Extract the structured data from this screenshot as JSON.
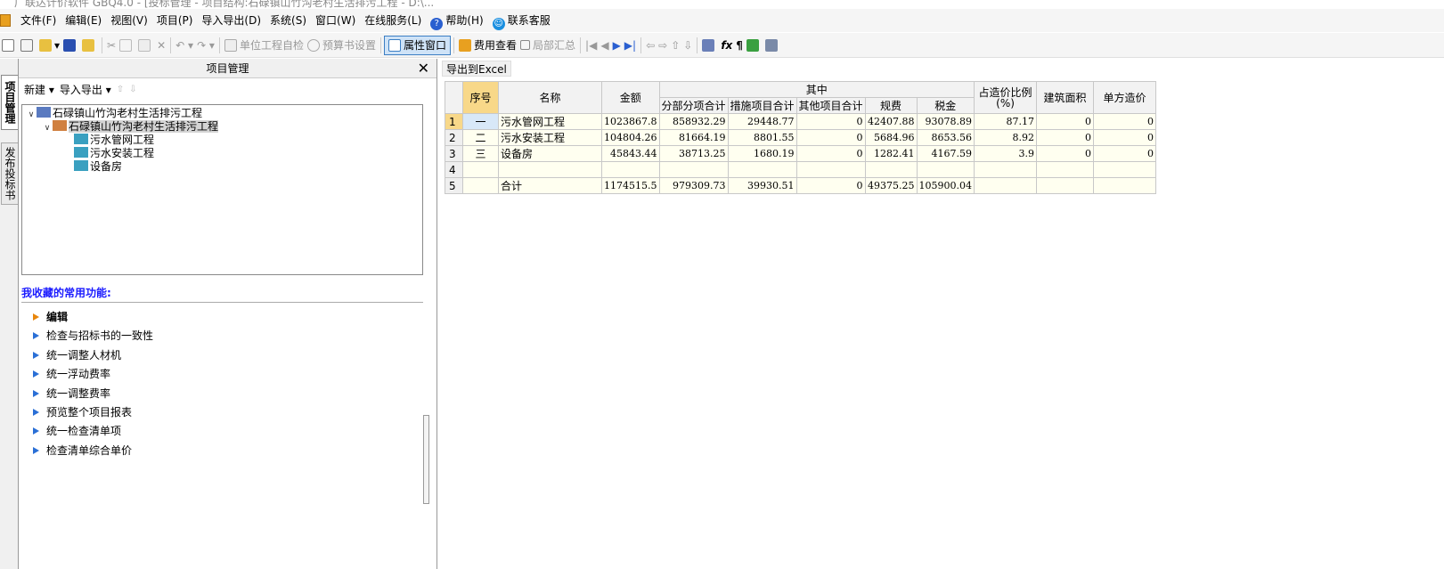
{
  "window": {
    "title": "广联达计价软件 GBQ4.0 - [投标管理 - 项目结构:石碌镇山竹沟老村生活排污工程 - D:\\..."
  },
  "menu": {
    "items": [
      "文件(F)",
      "编辑(E)",
      "视图(V)",
      "项目(P)",
      "导入导出(D)",
      "系统(S)",
      "窗口(W)",
      "在线服务(L)",
      "帮助(H)",
      "联系客服"
    ]
  },
  "toolbar": {
    "unit_check": "单位工程自检",
    "budget_settings": "预算书设置",
    "property_window": "属性窗口",
    "cost_view": "费用查看",
    "partial_summary": "局部汇总"
  },
  "vtabs": {
    "project_mgmt": "项目管理",
    "publish_bid": "发布投标书"
  },
  "left_panel": {
    "title": "项目管理",
    "new_label": "新建",
    "import_export_label": "导入导出",
    "tree": {
      "root": "石碌镇山竹沟老村生活排污工程",
      "child": "石碌镇山竹沟老村生活排污工程",
      "leaves": [
        "污水管网工程",
        "污水安装工程",
        "设备房"
      ]
    },
    "favorites_title": "我收藏的常用功能:",
    "favorites": [
      "编辑",
      "检查与招标书的一致性",
      "统一调整人材机",
      "统一浮动费率",
      "统一调整费率",
      "预览整个项目报表",
      "统一检查清单项",
      "检查清单综合单价"
    ]
  },
  "right_panel": {
    "export_label": "导出到Excel",
    "headers": {
      "seq": "序号",
      "name": "名称",
      "amount": "金额",
      "group": "其中",
      "sub_items": "分部分项合计",
      "measures": "措施项目合计",
      "other": "其他项目合计",
      "fees": "规费",
      "tax": "税金",
      "ratio": "占造价比例(%)",
      "area": "建筑面积",
      "unit_cost": "单方造价"
    },
    "rows": [
      {
        "n": "1",
        "seq": "一",
        "name": "污水管网工程",
        "amount": "1023867.8",
        "sub": "858932.29",
        "meas": "29448.77",
        "other": "0",
        "fees": "42407.88",
        "tax": "93078.89",
        "ratio": "87.17",
        "area": "0",
        "unit": "0"
      },
      {
        "n": "2",
        "seq": "二",
        "name": "污水安装工程",
        "amount": "104804.26",
        "sub": "81664.19",
        "meas": "8801.55",
        "other": "0",
        "fees": "5684.96",
        "tax": "8653.56",
        "ratio": "8.92",
        "area": "0",
        "unit": "0"
      },
      {
        "n": "3",
        "seq": "三",
        "name": "设备房",
        "amount": "45843.44",
        "sub": "38713.25",
        "meas": "1680.19",
        "other": "0",
        "fees": "1282.41",
        "tax": "4167.59",
        "ratio": "3.9",
        "area": "0",
        "unit": "0"
      },
      {
        "n": "4",
        "seq": "",
        "name": "",
        "amount": "",
        "sub": "",
        "meas": "",
        "other": "",
        "fees": "",
        "tax": "",
        "ratio": "",
        "area": "",
        "unit": ""
      },
      {
        "n": "5",
        "seq": "",
        "name": "合计",
        "amount": "1174515.5",
        "sub": "979309.73",
        "meas": "39930.51",
        "other": "0",
        "fees": "49375.25",
        "tax": "105900.04",
        "ratio": "",
        "area": "",
        "unit": ""
      }
    ]
  }
}
